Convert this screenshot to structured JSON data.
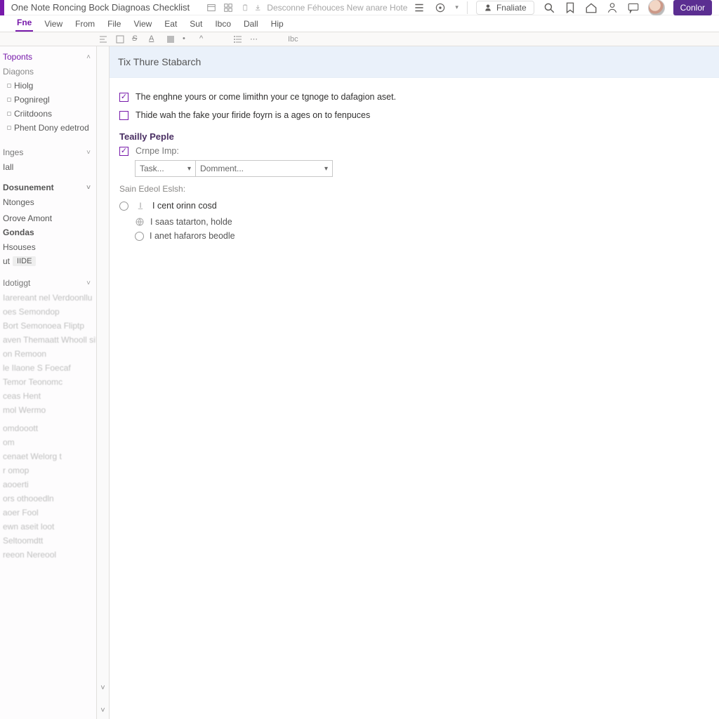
{
  "title": "One Note Roncing Bock Diagnoas Checklist",
  "search_placeholder": "Desconne Féhouces New anare Hote",
  "finalize_label": "Fnaliate",
  "primary_button": "Conlor",
  "ribbon_tabs": {
    "file": "Fne",
    "view1": "View",
    "from": "From",
    "file2": "File",
    "view2": "View",
    "eat": "Eat",
    "sut": "Sut",
    "ibco": "Ibco",
    "dal": "Dall",
    "hip": "Hip"
  },
  "ribbon_tool_label": "Ibc",
  "sidebar": {
    "sec1_header": "Toponts",
    "sec1_sub": "Diagons",
    "sec1_items": [
      "Hiolg",
      "Pogniregl",
      "Criitdoons",
      "Phent Dony edetrod"
    ],
    "sec2_header": "Inges",
    "sec2_item": "Iall",
    "sec3_header": "Dosunement",
    "sec3_item": "Ntonges",
    "sec4_plain": "Orove Amont",
    "sec5_header": "Gondas",
    "sec5_item": "Hsouses",
    "sec5_prefix": "ut",
    "sec5_tag": "IIDE",
    "sec6_header": "Idotiggt",
    "blur_items": [
      "Iarereant nel Verdoonllu",
      "oes   Semondop",
      "Bort   Semonoea Fliptp",
      "aven Themaatt Whooll sill",
      "on   Remoon",
      "le  Ilaone   S Foecaf",
      "Temor  Teonomc",
      "ceas   Hent",
      "mol    Wermo",
      "",
      "omdooott",
      "om",
      "cenaet   Welorg t",
      "r omop",
      "aooerti",
      "ors  othooedln",
      "aoer   Fool",
      "ewn aseit loot",
      "   Seltoomdtt",
      "reeon   Nereool"
    ]
  },
  "page": {
    "banner_title": "Tix Thure Stabarch",
    "check1": "The enghne yours or come limithn your ce tgnoge to dafagion aset.",
    "check2": "Thide wah the fake your firide foyrn is a ages on to fenpuces",
    "subhead": "Teailly Peple",
    "check3": "Crnpe Imp:",
    "select1_placeholder": "Task...",
    "select2_placeholder": "Domment...",
    "muted_label": "Sain Edeol Eslsh:",
    "radio1": "I cent orinn cosd",
    "radio2": "I saas tatarton, holde",
    "radio3": "I anet hafarors beodle"
  }
}
